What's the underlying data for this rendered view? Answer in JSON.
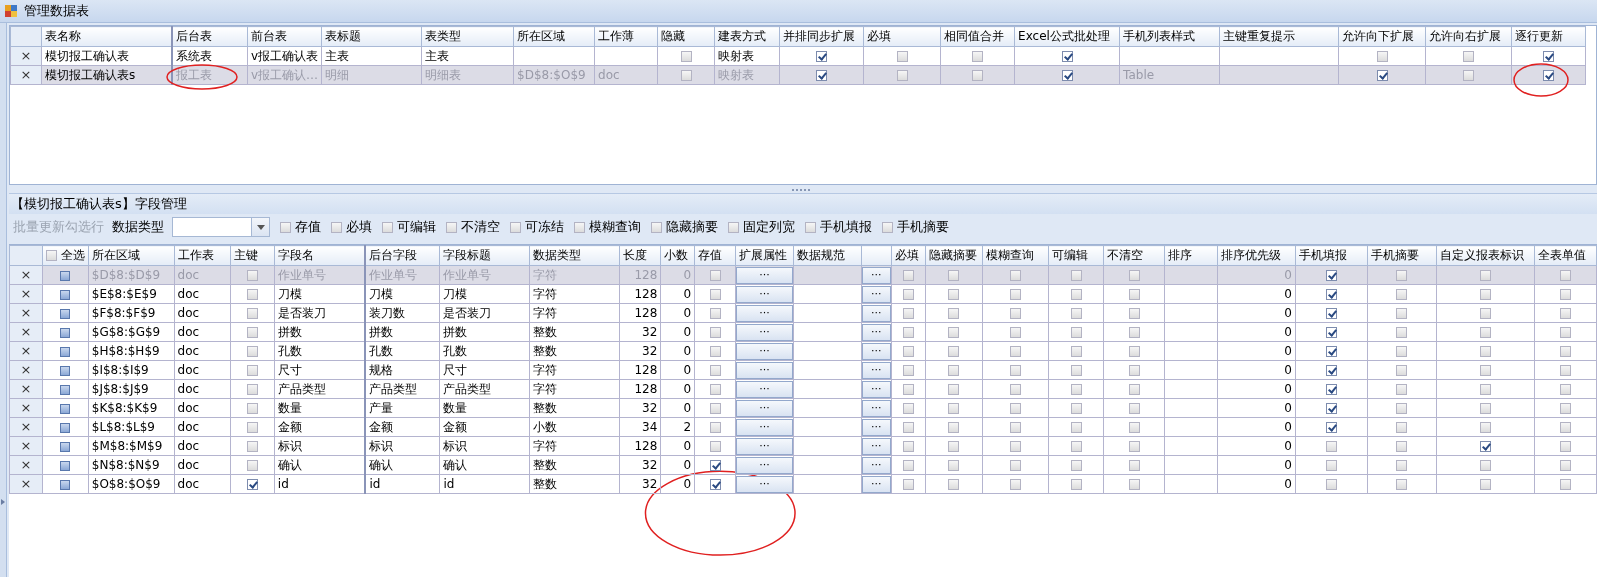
{
  "window": {
    "title": "管理数据表"
  },
  "top_grid": {
    "columns": [
      {
        "label": "表名称",
        "kind": "text"
      },
      {
        "label": "后台表",
        "kind": "text"
      },
      {
        "label": "前台表",
        "kind": "text"
      },
      {
        "label": "表标题",
        "kind": "text"
      },
      {
        "label": "表类型",
        "kind": "text"
      },
      {
        "label": "所在区域",
        "kind": "text"
      },
      {
        "label": "工作薄",
        "kind": "text"
      },
      {
        "label": "隐藏",
        "kind": "check"
      },
      {
        "label": "建表方式",
        "kind": "text"
      },
      {
        "label": "并排同步扩展",
        "kind": "check"
      },
      {
        "label": "必填",
        "kind": "check"
      },
      {
        "label": "相同值合并",
        "kind": "check"
      },
      {
        "label": "Excel公式批处理",
        "kind": "check"
      },
      {
        "label": "手机列表样式",
        "kind": "text"
      },
      {
        "label": "主键重复提示",
        "kind": "text"
      },
      {
        "label": "允许向下扩展",
        "kind": "check"
      },
      {
        "label": "允许向右扩展",
        "kind": "check"
      },
      {
        "label": "逐行更新",
        "kind": "check"
      }
    ],
    "rows": [
      {
        "remove": "×",
        "selected": false,
        "cells": [
          "模切报工确认表",
          "系统表",
          "v报工确认表",
          "主表",
          "主表",
          null,
          null,
          false,
          "映射表",
          true,
          false,
          false,
          true,
          null,
          null,
          false,
          false,
          true
        ]
      },
      {
        "remove": "×",
        "selected": true,
        "cells": [
          "模切报工确认表s",
          "报工表",
          "v报工确认…",
          "明细",
          "明细表",
          "$D$8:$O$9",
          "doc",
          false,
          "映射表",
          true,
          false,
          false,
          true,
          "Table",
          null,
          true,
          false,
          true
        ]
      }
    ]
  },
  "field_panel": {
    "title": "【模切报工确认表s】字段管理",
    "toolbar": {
      "batch_label": "批量更新勾选行",
      "batch_disabled": true,
      "type_label": "数据类型",
      "options": [
        {
          "label": "存值",
          "checked": false
        },
        {
          "label": "必填",
          "checked": false
        },
        {
          "label": "可编辑",
          "checked": false
        },
        {
          "label": "不清空",
          "checked": false
        },
        {
          "label": "可冻结",
          "checked": false
        },
        {
          "label": "模糊查询",
          "checked": false
        },
        {
          "label": "隐藏摘要",
          "checked": false
        },
        {
          "label": "固定列宽",
          "checked": false
        },
        {
          "label": "手机填报",
          "checked": false
        },
        {
          "label": "手机摘要",
          "checked": false
        }
      ]
    },
    "grid": {
      "columns": [
        {
          "label": "全选",
          "kind": "rowcheck",
          "checked": false
        },
        {
          "label": "所在区域",
          "kind": "text"
        },
        {
          "label": "工作表",
          "kind": "text"
        },
        {
          "label": "主键",
          "kind": "check"
        },
        {
          "label": "字段名",
          "kind": "text"
        },
        {
          "label": "后台字段",
          "kind": "text"
        },
        {
          "label": "字段标题",
          "kind": "text"
        },
        {
          "label": "数据类型",
          "kind": "text"
        },
        {
          "label": "长度",
          "kind": "num"
        },
        {
          "label": "小数",
          "kind": "num"
        },
        {
          "label": "存值",
          "kind": "check"
        },
        {
          "label": "扩展属性",
          "kind": "button"
        },
        {
          "label": "数据规范",
          "kind": "text"
        },
        {
          "kind": "button"
        },
        {
          "label": "必填",
          "kind": "check"
        },
        {
          "label": "隐藏摘要",
          "kind": "check"
        },
        {
          "label": "模糊查询",
          "kind": "check"
        },
        {
          "label": "可编辑",
          "kind": "check"
        },
        {
          "label": "不清空",
          "kind": "check"
        },
        {
          "label": "排序",
          "kind": "text"
        },
        {
          "label": "排序优先级",
          "kind": "num"
        },
        {
          "label": "手机填报",
          "kind": "check"
        },
        {
          "label": "手机摘要",
          "kind": "check"
        },
        {
          "label": "自定义报表标识",
          "kind": "check"
        },
        {
          "label": "全表单值",
          "kind": "check"
        }
      ],
      "rows": [
        {
          "remove": "×",
          "selected": true,
          "cells": [
            false,
            "$D$8:$D$9",
            "doc",
            false,
            "作业单号",
            "作业单号",
            "作业单号",
            "字符",
            "128",
            "0",
            false,
            "···",
            null,
            "···",
            false,
            false,
            false,
            false,
            false,
            null,
            "0",
            true,
            false,
            false,
            false
          ]
        },
        {
          "remove": "×",
          "selected": false,
          "cells": [
            false,
            "$E$8:$E$9",
            "doc",
            false,
            "刀模",
            "刀模",
            "刀模",
            "字符",
            "128",
            "0",
            false,
            "···",
            null,
            "···",
            false,
            false,
            false,
            false,
            false,
            null,
            "0",
            true,
            false,
            false,
            false
          ]
        },
        {
          "remove": "×",
          "selected": false,
          "cells": [
            false,
            "$F$8:$F$9",
            "doc",
            false,
            "是否装刀",
            "装刀数",
            "是否装刀",
            "字符",
            "128",
            "0",
            false,
            "···",
            null,
            "···",
            false,
            false,
            false,
            false,
            false,
            null,
            "0",
            true,
            false,
            false,
            false
          ]
        },
        {
          "remove": "×",
          "selected": false,
          "cells": [
            false,
            "$G$8:$G$9",
            "doc",
            false,
            "拼数",
            "拼数",
            "拼数",
            "整数",
            "32",
            "0",
            false,
            "···",
            null,
            "···",
            false,
            false,
            false,
            false,
            false,
            null,
            "0",
            true,
            false,
            false,
            false
          ]
        },
        {
          "remove": "×",
          "selected": false,
          "cells": [
            false,
            "$H$8:$H$9",
            "doc",
            false,
            "孔数",
            "孔数",
            "孔数",
            "整数",
            "32",
            "0",
            false,
            "···",
            null,
            "···",
            false,
            false,
            false,
            false,
            false,
            null,
            "0",
            true,
            false,
            false,
            false
          ]
        },
        {
          "remove": "×",
          "selected": false,
          "cells": [
            false,
            "$I$8:$I$9",
            "doc",
            false,
            "尺寸",
            "规格",
            "尺寸",
            "字符",
            "128",
            "0",
            false,
            "···",
            null,
            "···",
            false,
            false,
            false,
            false,
            false,
            null,
            "0",
            true,
            false,
            false,
            false
          ]
        },
        {
          "remove": "×",
          "selected": false,
          "cells": [
            false,
            "$J$8:$J$9",
            "doc",
            false,
            "产品类型",
            "产品类型",
            "产品类型",
            "字符",
            "128",
            "0",
            false,
            "···",
            null,
            "···",
            false,
            false,
            false,
            false,
            false,
            null,
            "0",
            true,
            false,
            false,
            false
          ]
        },
        {
          "remove": "×",
          "selected": false,
          "cells": [
            false,
            "$K$8:$K$9",
            "doc",
            false,
            "数量",
            "产量",
            "数量",
            "整数",
            "32",
            "0",
            false,
            "···",
            null,
            "···",
            false,
            false,
            false,
            false,
            false,
            null,
            "0",
            true,
            false,
            false,
            false
          ]
        },
        {
          "remove": "×",
          "selected": false,
          "cells": [
            false,
            "$L$8:$L$9",
            "doc",
            false,
            "金额",
            "金额",
            "金额",
            "小数",
            "34",
            "2",
            false,
            "···",
            null,
            "···",
            false,
            false,
            false,
            false,
            false,
            null,
            "0",
            true,
            false,
            false,
            false
          ]
        },
        {
          "remove": "×",
          "selected": false,
          "cells": [
            false,
            "$M$8:$M$9",
            "doc",
            false,
            "标识",
            "标识",
            "标识",
            "字符",
            "128",
            "0",
            false,
            "···",
            null,
            "···",
            false,
            false,
            false,
            false,
            false,
            null,
            "0",
            false,
            false,
            true,
            false
          ]
        },
        {
          "remove": "×",
          "selected": false,
          "cells": [
            false,
            "$N$8:$N$9",
            "doc",
            false,
            "确认",
            "确认",
            "确认",
            "整数",
            "32",
            "0",
            true,
            "···",
            null,
            "···",
            false,
            false,
            false,
            false,
            false,
            null,
            "0",
            false,
            false,
            false,
            false
          ]
        },
        {
          "remove": "×",
          "selected": false,
          "cells": [
            false,
            "$O$8:$O$9",
            "doc",
            true,
            "id",
            "id",
            "id",
            "整数",
            "32",
            "0",
            true,
            "···",
            null,
            "···",
            false,
            false,
            false,
            false,
            false,
            null,
            "0",
            false,
            false,
            false,
            false
          ]
        }
      ]
    }
  }
}
